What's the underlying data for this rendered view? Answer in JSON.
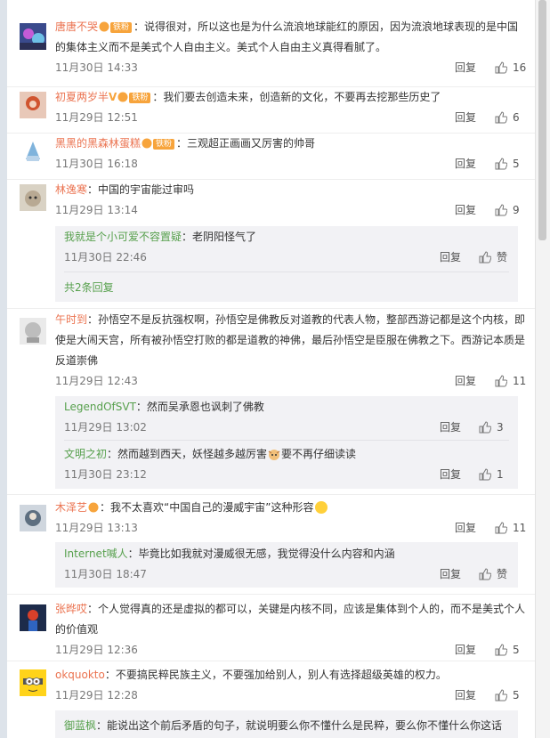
{
  "comments": [
    {
      "user": "唐唐不哭",
      "badge": "铁粉",
      "text": "：说得很对，所以这也是为什么流浪地球能红的原因，因为流浪地球表现的是中国的集体主义而不是美式个人自由主义。美式个人自由主义真得看腻了。",
      "time": "11月30日 14:33",
      "reply": "回复",
      "likes": "16"
    },
    {
      "user": "初夏两岁半",
      "badge": "铁粉",
      "text": "：我们要去创造未来，创造新的文化，不要再去挖那些历史了",
      "time": "11月29日 12:51",
      "reply": "回复",
      "likes": "6"
    },
    {
      "user": "黑黑的黑森林蛋糕",
      "badge": "铁粉",
      "text": "：三观超正画画又厉害的帅哥",
      "time": "11月30日 16:18",
      "reply": "回复",
      "likes": "5"
    },
    {
      "user": "林逸寒",
      "text": "：中国的宇宙能过审吗",
      "time": "11月29日 13:14",
      "reply": "回复",
      "likes": "9",
      "replies": [
        {
          "user": "我就是个小可爱不容置疑",
          "text": "：老阴阳怪气了",
          "time": "11月30日 22:46",
          "reply": "回复",
          "likes": "赞"
        }
      ],
      "more": "共2条回复"
    },
    {
      "user": "午时到",
      "text": "：孙悟空不是反抗强权啊，孙悟空是佛教反对道教的代表人物，整部西游记都是这个内核，即使是大闹天宫，所有被孙悟空打败的都是道教的神佛，最后孙悟空是臣服在佛教之下。西游记本质是反道崇佛",
      "time": "11月29日 12:43",
      "reply": "回复",
      "likes": "11",
      "replies": [
        {
          "user": "LegendOfSVT",
          "text": "：然而吴承恩也讽刺了佛教",
          "time": "11月29日 13:02",
          "reply": "回复",
          "likes": "3"
        },
        {
          "user": "文明之初",
          "text": "：然而越到西天，妖怪越多越厉害",
          "text2": "要不再仔细读读",
          "time": "11月30日 23:12",
          "reply": "回复",
          "likes": "1"
        }
      ]
    },
    {
      "user": "木泽艺",
      "text": "：我不太喜欢“中国自己的漫威宇宙”这种形容",
      "time": "11月29日 13:13",
      "reply": "回复",
      "likes": "11",
      "replies": [
        {
          "user": "Internet喊人",
          "text": "：毕竟比如我就对漫威很无感，我觉得没什么内容和内涵",
          "time": "11月30日 18:47",
          "reply": "回复",
          "likes": "赞"
        }
      ]
    },
    {
      "user": "张晔哎",
      "text": "：个人觉得真的还是虚拟的都可以，关键是内核不同，应该是集体到个人的，而不是美式个人的价值观",
      "time": "11月29日 12:36",
      "reply": "回复",
      "likes": "5"
    },
    {
      "user": "okquokto",
      "text": "：不要搞民粹民族主义，不要强加给别人，别人有选择超级英雄的权力。",
      "time": "11月29日 12:28",
      "reply": "回复",
      "likes": "5",
      "replies": [
        {
          "user": "御蓝枫",
          "text": "：能说出这个前后矛盾的句子，就说明要么你不懂什么是民粹，要么你不懂什么你这话"
        }
      ]
    }
  ],
  "colors": {
    "username": "#eb7350",
    "reply_username": "#57a04d",
    "fan_badge": "#f7a43c",
    "background": "#dde3ea"
  }
}
